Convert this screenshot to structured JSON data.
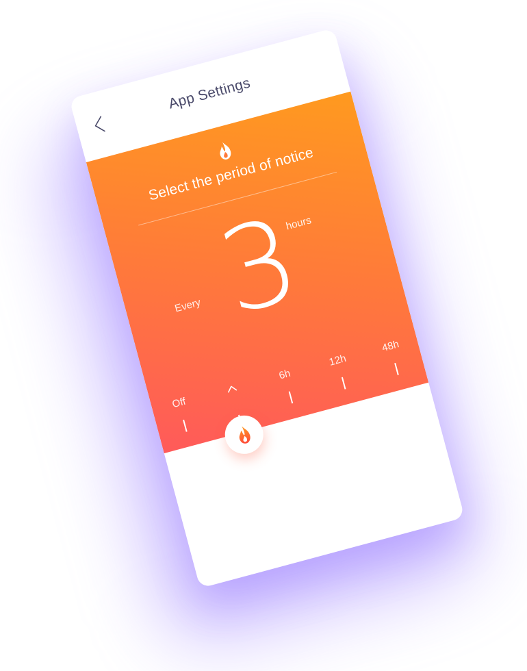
{
  "header": {
    "title": "App Settings",
    "back_icon": "chevron-left-icon"
  },
  "notice": {
    "icon": "flame-icon",
    "subtitle": "Select the period of notice",
    "prefix": "Every",
    "value": "3",
    "unit": "hours"
  },
  "scale": {
    "ticks": [
      {
        "label": "Off"
      },
      {
        "label": ""
      },
      {
        "label": "6h"
      },
      {
        "label": "12h"
      },
      {
        "label": "48h"
      }
    ],
    "selected_index": 1,
    "selected_icon": "chevron-up-icon"
  },
  "slider": {
    "handle_icon": "flame-icon"
  },
  "colors": {
    "gradient_start": "#ff9a1f",
    "gradient_end": "#ff5a5a",
    "glow": "#a58bff",
    "title_text": "#4a4a6a"
  }
}
